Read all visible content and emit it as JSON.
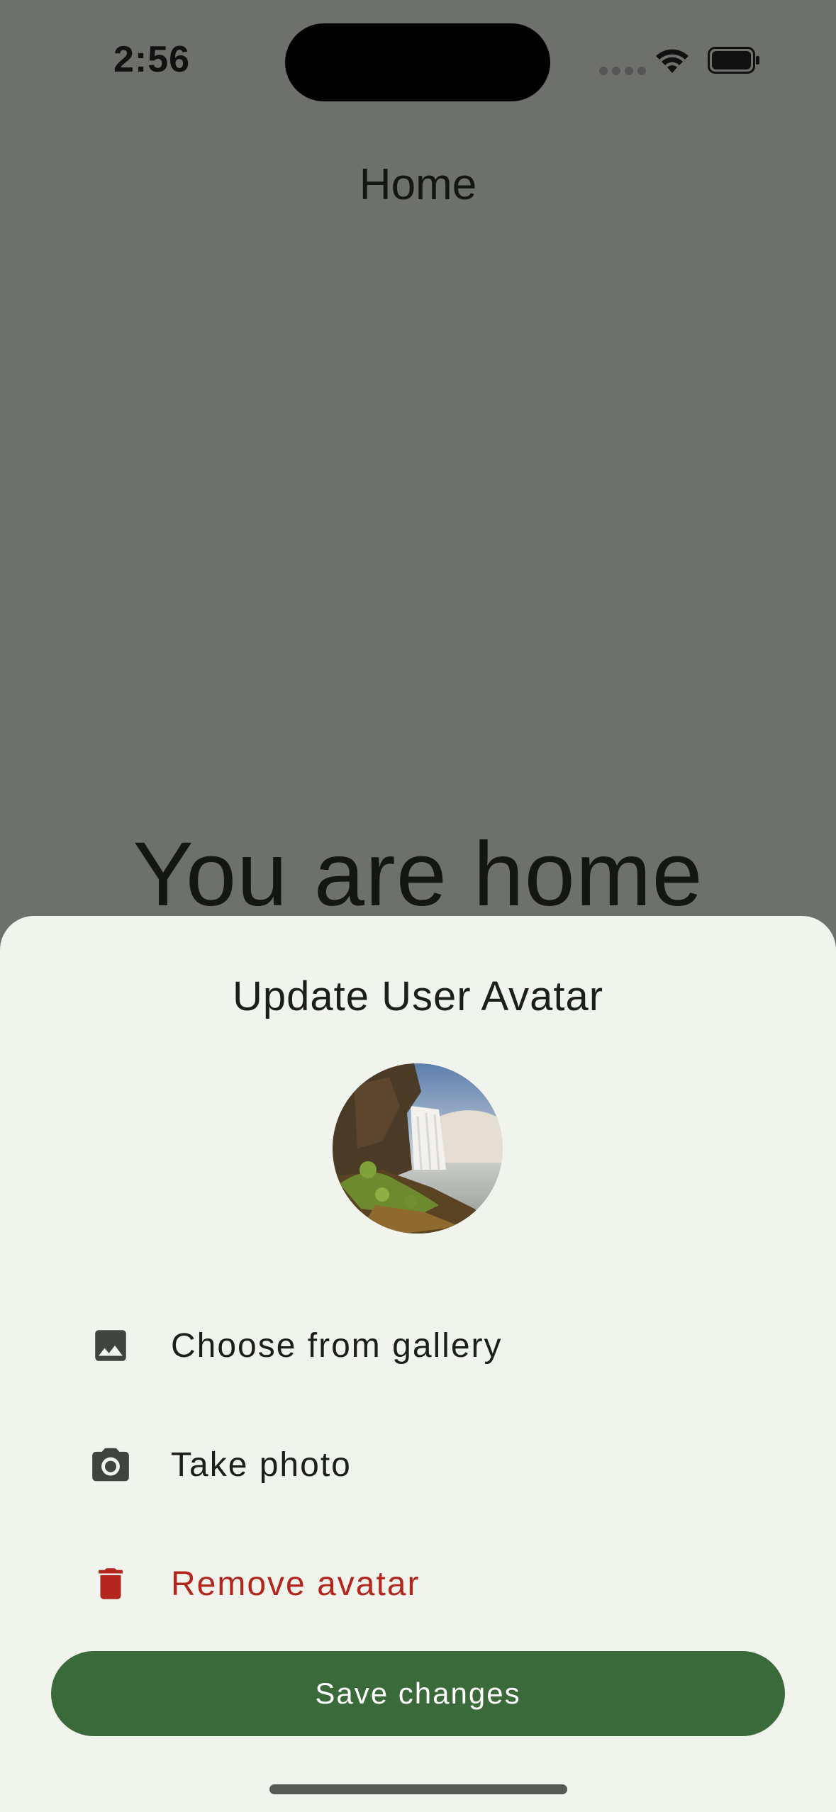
{
  "status_bar": {
    "time": "2:56"
  },
  "app_bar": {
    "title": "Home"
  },
  "main": {
    "message": "You are home"
  },
  "sheet": {
    "title": "Update User Avatar",
    "avatar": {
      "icon": "landscape-photo"
    },
    "options": [
      {
        "label": "Choose from gallery",
        "icon": "image-icon"
      },
      {
        "label": "Take photo",
        "icon": "camera-icon"
      },
      {
        "label": "Remove avatar",
        "icon": "trash-icon",
        "color": "#b3261e"
      }
    ],
    "save_label": "Save changes"
  },
  "colors": {
    "scrim": "#6e706b",
    "sheet_bg": "#f1f4ed",
    "primary": "#3b6a3a",
    "danger": "#b3261e",
    "icon": "#3f443e"
  }
}
